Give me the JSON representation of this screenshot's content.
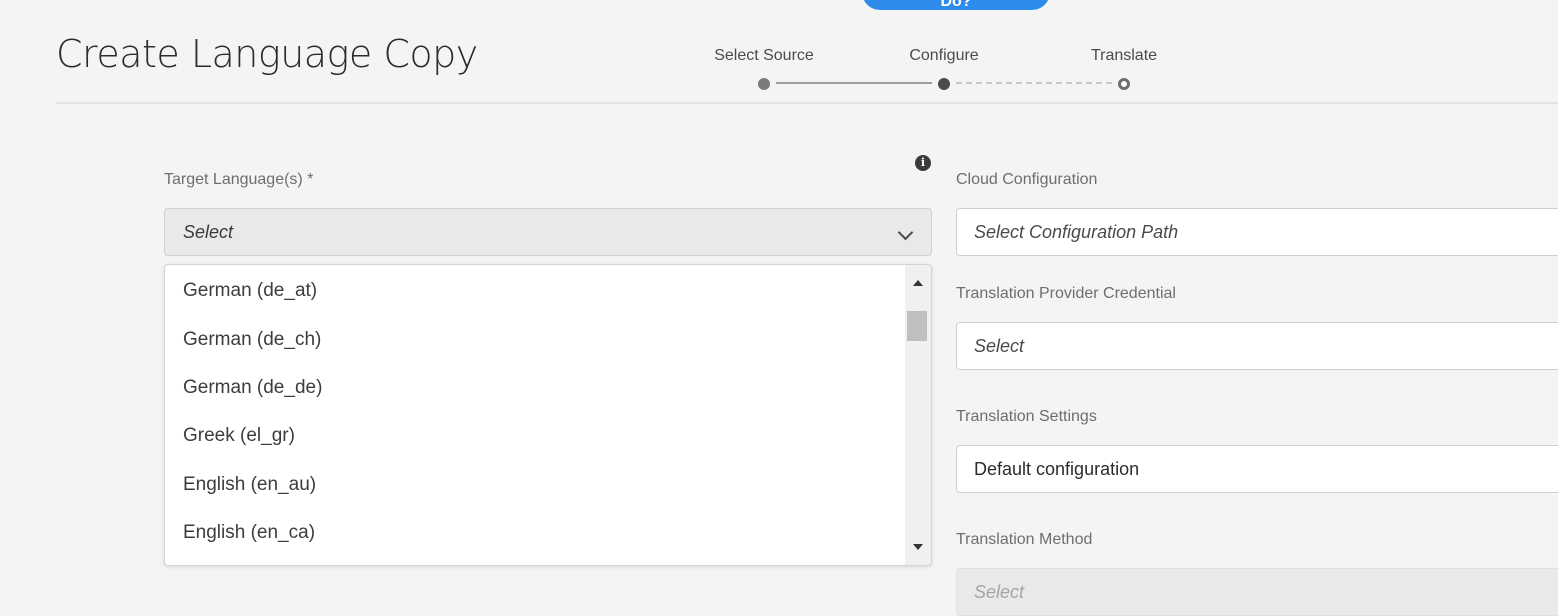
{
  "top_button": {
    "label": "Do?"
  },
  "page": {
    "title": "Create Language Copy"
  },
  "stepper": {
    "steps": [
      {
        "label": "Select Source",
        "state": "done"
      },
      {
        "label": "Configure",
        "state": "current"
      },
      {
        "label": "Translate",
        "state": "pending"
      }
    ]
  },
  "target_language": {
    "label": "Target Language(s) *",
    "placeholder": "Select",
    "options": [
      "German (de_at)",
      "German (de_ch)",
      "German (de_de)",
      "Greek (el_gr)",
      "English (en_au)",
      "English (en_ca)"
    ]
  },
  "cloud_configuration": {
    "label": "Cloud Configuration",
    "placeholder": "Select Configuration Path"
  },
  "translation_provider_credential": {
    "label": "Translation Provider Credential",
    "placeholder": "Select"
  },
  "translation_settings": {
    "label": "Translation Settings",
    "value": "Default configuration"
  },
  "translation_method": {
    "label": "Translation Method",
    "placeholder": "Select"
  },
  "colors": {
    "accent": "#2d8ceb",
    "background": "#f4f4f4"
  }
}
